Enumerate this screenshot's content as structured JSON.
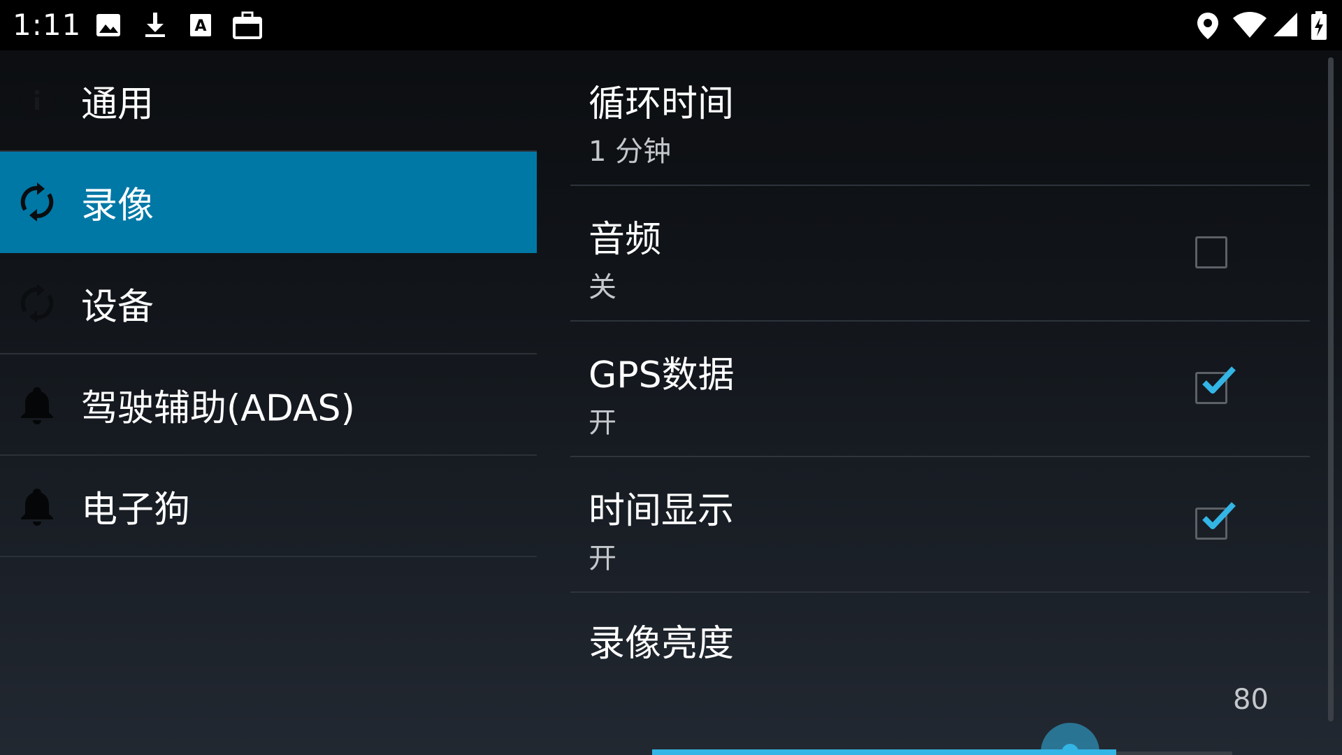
{
  "status_bar": {
    "time": "1:11",
    "left_icons": [
      "image-icon",
      "download-icon",
      "text-a-icon",
      "briefcase-icon"
    ],
    "right_icons": [
      "location-icon",
      "wifi-icon",
      "signal-icon",
      "battery-charging-icon"
    ]
  },
  "nav": {
    "items": [
      {
        "label": "通用",
        "icon": "info-icon",
        "selected": false
      },
      {
        "label": "录像",
        "icon": "sync-icon",
        "selected": true
      },
      {
        "label": "设备",
        "icon": "sync-icon",
        "selected": false
      },
      {
        "label": "驾驶辅助(ADAS)",
        "icon": "bell-icon",
        "selected": false
      },
      {
        "label": "电子狗",
        "icon": "bell-icon",
        "selected": false
      }
    ]
  },
  "prefs": {
    "loop_time": {
      "title": "循环时间",
      "summary": "1 分钟"
    },
    "audio": {
      "title": "音频",
      "summary": "关",
      "checked": false
    },
    "gps": {
      "title": "GPS数据",
      "summary": "开",
      "checked": true
    },
    "time_display": {
      "title": "时间显示",
      "summary": "开",
      "checked": true
    },
    "brightness": {
      "title": "录像亮度",
      "value": "80",
      "fraction": 0.8
    }
  },
  "colors": {
    "accent": "#33b5e5",
    "selected_bg": "#0078a6",
    "status_bar_bg": "#000000"
  }
}
